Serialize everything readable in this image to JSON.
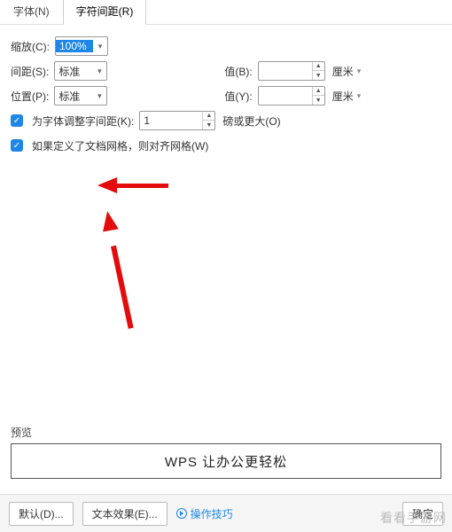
{
  "tabs": {
    "font": "字体(N)",
    "spacing": "字符间距(R)"
  },
  "zoom": {
    "label": "缩放(C):",
    "value": "100%"
  },
  "spacing": {
    "label": "间距(S):",
    "value": "标准",
    "val_label": "值(B):",
    "val_value": "",
    "unit": "厘米"
  },
  "position": {
    "label": "位置(P):",
    "value": "标准",
    "val_label": "值(Y):",
    "val_value": "",
    "unit": "厘米"
  },
  "kerning": {
    "label": "为字体调整字间距(K):",
    "value": "1",
    "unit": "磅或更大(O)"
  },
  "snap": {
    "label": "如果定义了文档网格，则对齐网格(W)"
  },
  "preview": {
    "label": "预览",
    "text": "WPS 让办公更轻松"
  },
  "footer": {
    "default": "默认(D)...",
    "texteffect": "文本效果(E)...",
    "tips": "操作技巧",
    "ok": "确定"
  },
  "watermark": "看看手游网"
}
